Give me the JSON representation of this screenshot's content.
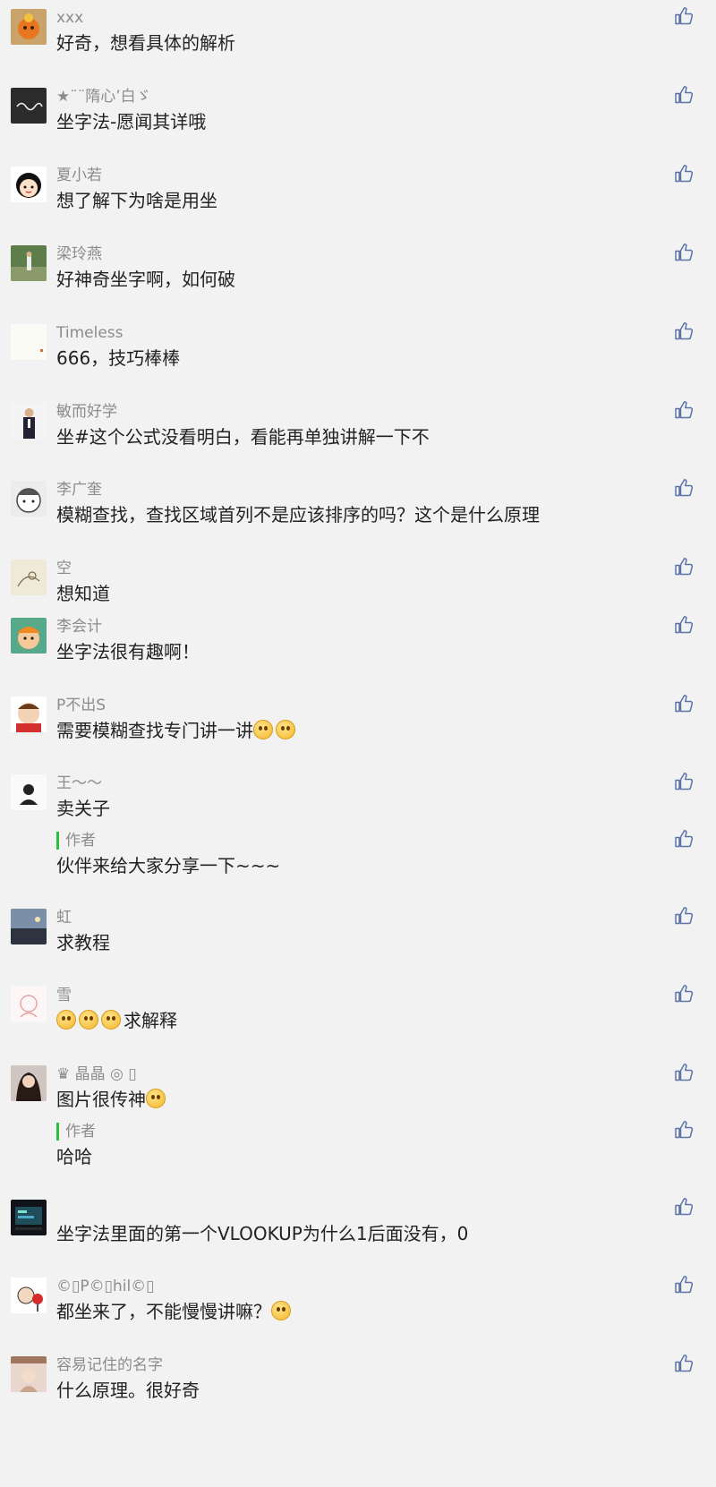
{
  "comments": [
    {
      "name": "xxx",
      "text": "好奇，想看具体的解析",
      "emoji_count": 0,
      "avatar": "orange-character-avatar"
    },
    {
      "name": "★¨¨隋心’白ゞ",
      "text": "坐字法-愿闻其详哦",
      "emoji_count": 0,
      "avatar": "dark-script-avatar"
    },
    {
      "name": "夏小若",
      "text": "想了解下为啥是用坐",
      "emoji_count": 0,
      "avatar": "cartoon-girl-avatar"
    },
    {
      "name": "梁玲燕",
      "text": "好神奇坐字啊，如何破",
      "emoji_count": 0,
      "avatar": "outdoor-photo-avatar"
    },
    {
      "name": "Timeless",
      "text": "666，技巧棒棒",
      "emoji_count": 0,
      "avatar": "blank-light-avatar"
    },
    {
      "name": "敏而好学",
      "text": "坐#这个公式没看明白，看能再单独讲解一下不",
      "emoji_count": 0,
      "avatar": "person-suit-avatar"
    },
    {
      "name": "李广奎",
      "text": "模糊查找，查找区域首列不是应该排序的吗？这个是什么原理",
      "emoji_count": 0,
      "avatar": "sketch-face-avatar"
    },
    {
      "name": "空",
      "text": "想知道",
      "emoji_count": 0,
      "avatar": "paper-sketch-avatar"
    },
    {
      "name": "李会计",
      "text": "坐字法很有趣啊！",
      "emoji_count": 0,
      "avatar": "cartoon-boy-avatar"
    },
    {
      "name": "P不出S",
      "text": "需要模糊查找专门讲一讲",
      "emoji_count": 2,
      "avatar": "red-cartoon-avatar"
    },
    {
      "name": "王～～",
      "text": "卖关子",
      "emoji_count": 0,
      "avatar": "silhouette-avatar",
      "reply": {
        "label": "作者",
        "text": "伙伴来给大家分享一下~~~"
      }
    },
    {
      "name": "虹",
      "text": "求教程",
      "emoji_count": 0,
      "avatar": "landscape-avatar"
    },
    {
      "name": "雪",
      "text": "求解释",
      "emoji_count": 3,
      "emoji_before": true,
      "avatar": "pink-sketch-avatar"
    },
    {
      "name": "♛ 晶晶 ◎ ▯",
      "text": "图片很传神",
      "emoji_count": 1,
      "avatar": "woman-photo-avatar",
      "reply": {
        "label": "作者",
        "text": "哈哈"
      }
    },
    {
      "name": "",
      "text": "坐字法里面的第一个VLOOKUP为什么1后面没有，0",
      "emoji_count": 0,
      "avatar": "dark-screen-avatar"
    },
    {
      "name": "©▯P©▯hil©▯",
      "text": "都坐来了，不能慢慢讲嘛？",
      "emoji_count": 1,
      "avatar": "fan-cartoon-avatar"
    },
    {
      "name": "容易记住的名字",
      "text": "什么原理。很好奇",
      "emoji_count": 0,
      "avatar": "girl-photo-avatar"
    }
  ]
}
